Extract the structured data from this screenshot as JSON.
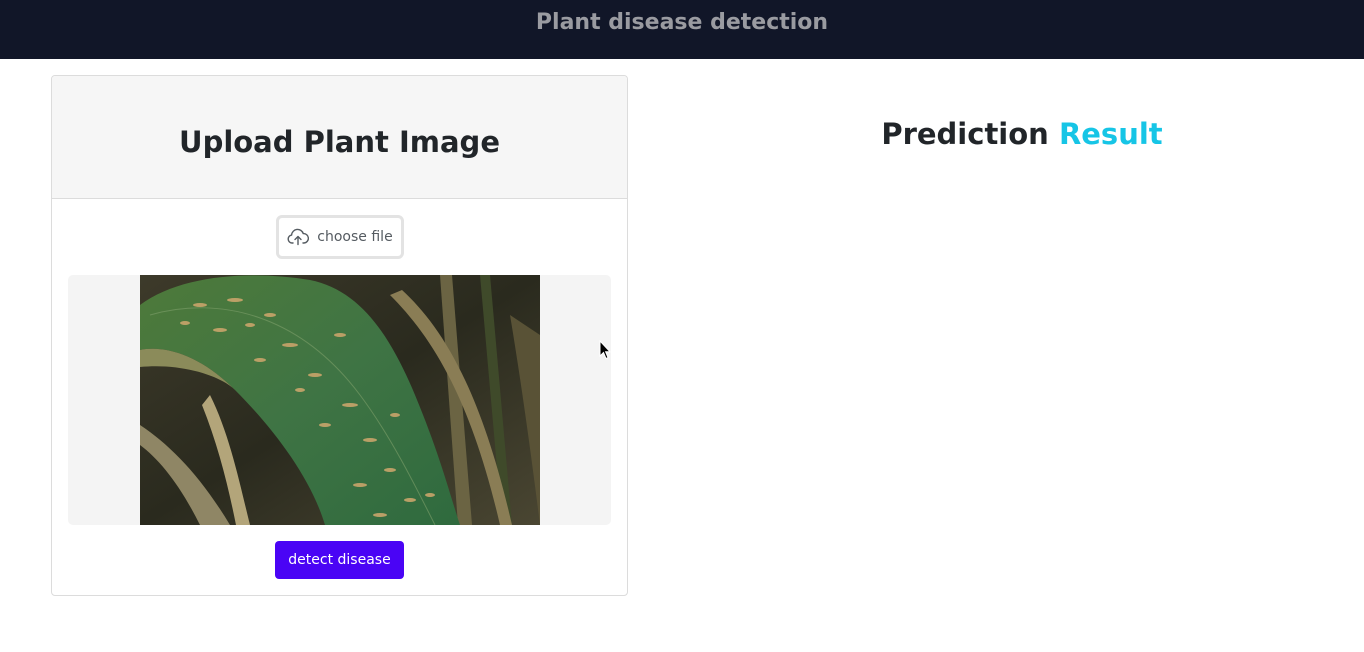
{
  "navbar": {
    "title": "Plant disease detection"
  },
  "upload_card": {
    "title": "Upload Plant Image",
    "file_button": {
      "label": "choose file",
      "icon": "cloud-upload-icon"
    },
    "preview": {
      "image": "corn-leaf-with-lesions"
    },
    "detect_button": {
      "label": "detect disease",
      "color": "#4a04f5"
    }
  },
  "prediction": {
    "title_part1": "Prediction",
    "title_part2": "Result",
    "accent_color": "#16c5e6"
  },
  "colors": {
    "navbar_bg": "#111628",
    "navbar_text": "#9a9ba1",
    "card_header_bg": "#f6f6f6",
    "preview_bg": "#f4f4f4"
  }
}
